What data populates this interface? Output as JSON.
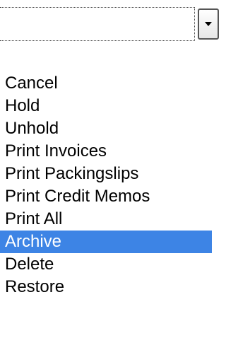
{
  "select": {
    "value": "",
    "arrow_icon": "chevron-down-icon"
  },
  "options": [
    {
      "label": "Cancel",
      "selected": false
    },
    {
      "label": "Hold",
      "selected": false
    },
    {
      "label": "Unhold",
      "selected": false
    },
    {
      "label": "Print Invoices",
      "selected": false
    },
    {
      "label": "Print Packingslips",
      "selected": false
    },
    {
      "label": "Print Credit Memos",
      "selected": false
    },
    {
      "label": "Print All",
      "selected": false
    },
    {
      "label": "Archive",
      "selected": true
    },
    {
      "label": "Delete",
      "selected": false
    },
    {
      "label": "Restore",
      "selected": false
    }
  ],
  "colors": {
    "highlight": "#3d84e5",
    "highlight_text": "#ffffff",
    "text": "#000000"
  }
}
